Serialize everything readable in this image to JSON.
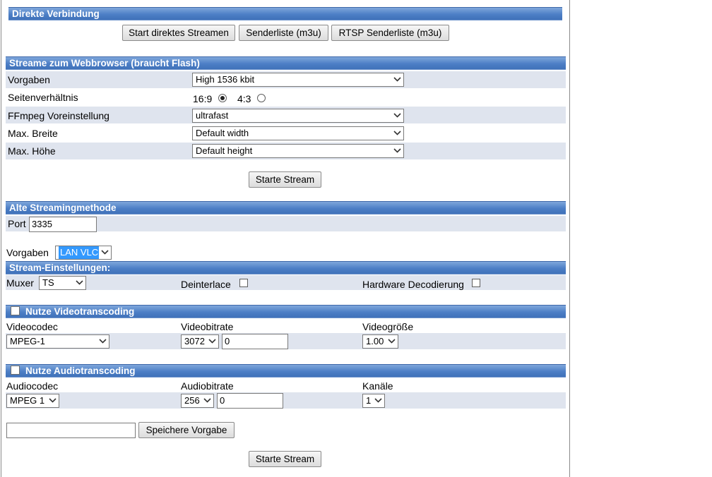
{
  "direkte": {
    "title": "Direkte Verbindung",
    "buttons": [
      "Start direktes Streamen",
      "Senderliste (m3u)",
      "RTSP Senderliste (m3u)"
    ]
  },
  "flash": {
    "title": "Streame zum Webbrowser (braucht Flash)",
    "rows": {
      "vorgaben_label": "Vorgaben",
      "vorgaben_value": "High 1536 kbit",
      "aspect_label": "Seitenverhältnis",
      "aspect_169": "16:9",
      "aspect_43": "4:3",
      "aspect_selected": "16:9",
      "ffmpeg_label": "FFmpeg Voreinstellung",
      "ffmpeg_value": "ultrafast",
      "width_label": "Max. Breite",
      "width_value": "Default width",
      "height_label": "Max. Höhe",
      "height_value": "Default height"
    },
    "start_button": "Starte Stream"
  },
  "alt": {
    "title": "Alte Streamingmethode",
    "port_label": "Port",
    "port_value": "3335",
    "vorgaben_label": "Vorgaben",
    "vorgaben_value": "LAN VLC"
  },
  "stream": {
    "title": "Stream-Einstellungen:",
    "muxer_label": "Muxer",
    "muxer_value": "TS",
    "deinterlace_label": "Deinterlace",
    "hw_label": "Hardware Decodierung"
  },
  "video": {
    "title": "Nutze Videotranscoding",
    "codec_label": "Videocodec",
    "codec_value": "MPEG-1",
    "bitrate_label": "Videobitrate",
    "bitrate_select": "3072",
    "bitrate_input": "0",
    "size_label": "Videogröße",
    "size_value": "1.00"
  },
  "audio": {
    "title": "Nutze Audiotranscoding",
    "codec_label": "Audiocodec",
    "codec_value": "MPEG 1",
    "bitrate_label": "Audiobitrate",
    "bitrate_select": "256",
    "bitrate_input": "0",
    "channels_label": "Kanäle",
    "channels_value": "1"
  },
  "save": {
    "input_value": "",
    "button": "Speichere Vorgabe"
  },
  "bottom_start": "Starte Stream"
}
